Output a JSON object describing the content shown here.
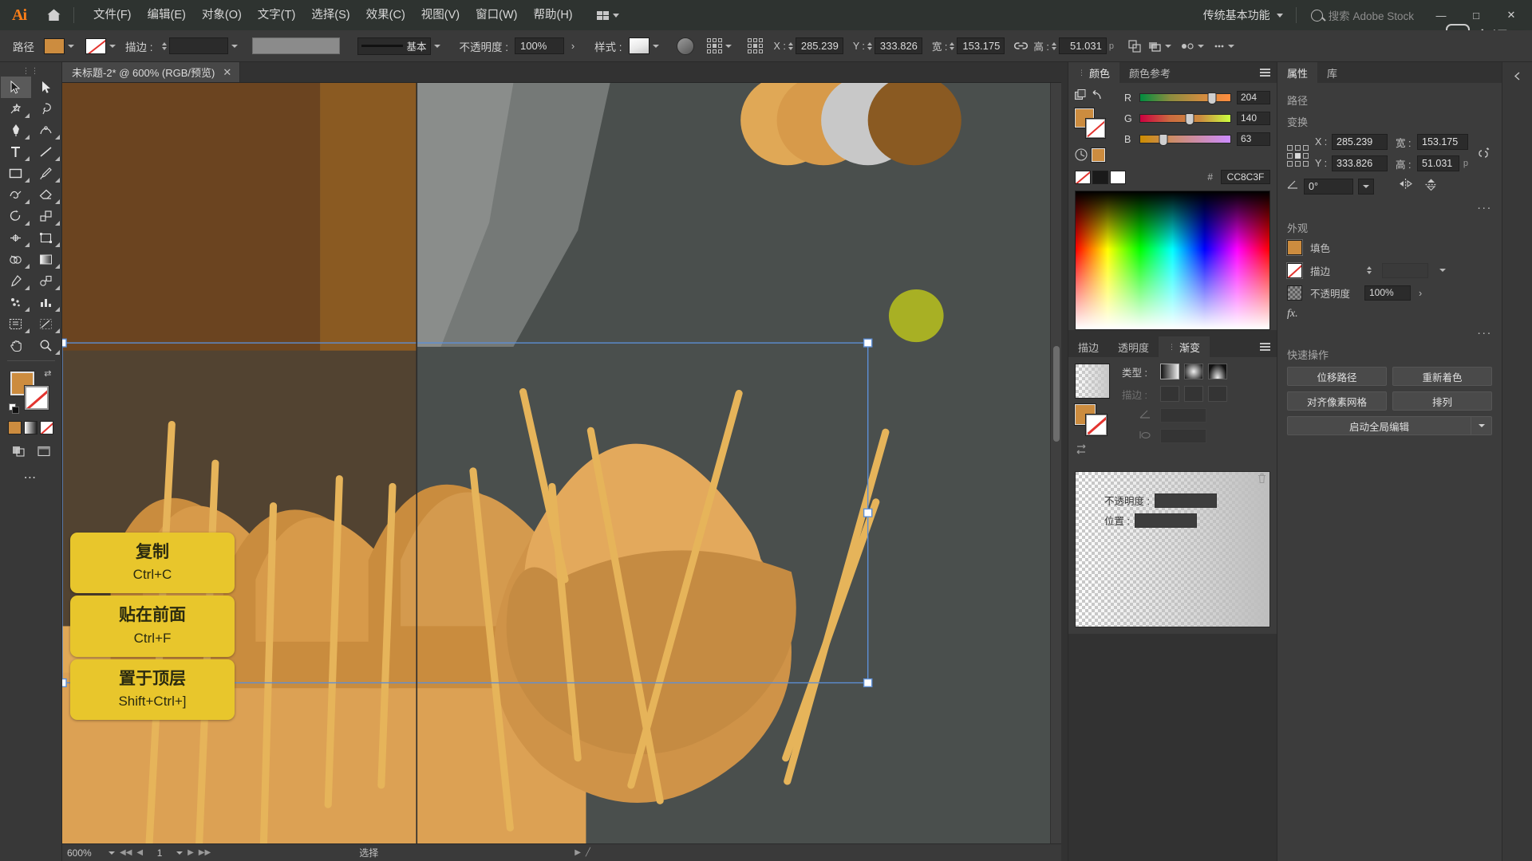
{
  "app": {
    "name": "Ai",
    "logo_color": "#ff7f18"
  },
  "menubar": {
    "items": [
      "文件(F)",
      "编辑(E)",
      "对象(O)",
      "文字(T)",
      "选择(S)",
      "效果(C)",
      "视图(V)",
      "窗口(W)",
      "帮助(H)"
    ],
    "arrange_icon": "arrange-documents-icon",
    "workspace": "传统基本功能",
    "search_placeholder": "搜索 Adobe Stock",
    "window_controls": [
      "minimize",
      "maximize",
      "close"
    ]
  },
  "watermark": {
    "text": "虎课网"
  },
  "controlbar": {
    "object_label": "路径",
    "fill_color": "#CC8C3F",
    "stroke_label": "描边 :",
    "stroke_weight": "",
    "stroke_profile": "基本",
    "opacity_label": "不透明度 :",
    "opacity_value": "100%",
    "style_label": "样式 :",
    "x_label": "X :",
    "x_value": "285.239",
    "y_label": "Y :",
    "y_value": "333.826",
    "w_label": "宽 :",
    "w_value": "153.175",
    "h_label": "高 :",
    "h_value": "51.031",
    "h_unit": "p"
  },
  "toolbar": {
    "tools": [
      "selection-tool",
      "direct-selection-tool",
      "magic-wand-tool",
      "lasso-tool",
      "pen-tool",
      "curvature-tool",
      "type-tool",
      "line-segment-tool",
      "rectangle-tool",
      "paintbrush-tool",
      "shaper-tool",
      "eraser-tool",
      "rotate-tool",
      "scale-tool",
      "width-tool",
      "free-transform-tool",
      "shape-builder-tool",
      "gradient-tool",
      "eyedropper-tool",
      "blend-tool",
      "symbol-sprayer-tool",
      "column-graph-tool",
      "artboard-tool",
      "slice-tool",
      "hand-tool",
      "zoom-tool"
    ],
    "fill_color": "#CC8C3F",
    "stroke_color": "none",
    "color_modes": [
      "solid-color",
      "gradient",
      "none"
    ],
    "screen_modes": [
      "normal-screen-mode",
      "full-screen-mode"
    ],
    "more_label": "..."
  },
  "document": {
    "tab_title": "未标题-2* @ 600% (RGB/预览)",
    "close_label": "✕"
  },
  "statusbar": {
    "zoom": "600%",
    "artboard_number": "1",
    "status_text": "选择"
  },
  "panels": {
    "color": {
      "tabs": [
        {
          "label": "颜色",
          "active": true
        },
        {
          "label": "颜色参考",
          "active": false
        }
      ],
      "channels": [
        {
          "label": "R",
          "value": "204"
        },
        {
          "label": "G",
          "value": "140"
        },
        {
          "label": "B",
          "value": "63"
        }
      ],
      "hex_symbol": "#",
      "hex_value": "CC8C3F",
      "fill_color": "#CC8C3F"
    },
    "gradient": {
      "tabs": [
        {
          "label": "描边",
          "active": false
        },
        {
          "label": "透明度",
          "active": false
        },
        {
          "label": "渐变",
          "active": true
        }
      ],
      "type_label": "类型 :",
      "type_options": [
        "linear-gradient",
        "radial-gradient",
        "freeform-gradient"
      ],
      "stroke_label": "描边 :",
      "angle_label": "角度",
      "angle_value": "",
      "aspect_label": "长宽比",
      "aspect_value": "",
      "opacity_label": "不透明度 :",
      "opacity_value": "",
      "location_label": "位置 :",
      "location_value": "",
      "delete_icon": "trash-icon"
    },
    "properties": {
      "tabs": [
        {
          "label": "属性",
          "active": true
        },
        {
          "label": "库",
          "active": false
        }
      ],
      "object_type": "路径",
      "transform_title": "变换",
      "x_label": "X :",
      "x_value": "285.239",
      "y_label": "Y :",
      "y_value": "333.826",
      "w_label": "宽 :",
      "w_value": "153.175",
      "h_label": "高 :",
      "h_value": "51.031",
      "h_unit": "p",
      "angle_value": "0°",
      "link_icon": "unlink-icon",
      "flip_h_icon": "flip-horizontal-icon",
      "flip_v_icon": "flip-vertical-icon",
      "more_options": "...",
      "appearance_title": "外观",
      "appearance_rows": [
        {
          "label": "填色",
          "value": ""
        },
        {
          "label": "描边",
          "value": ""
        },
        {
          "label": "不透明度",
          "value": "100%"
        }
      ],
      "fx_label": "fx.",
      "quick_actions_title": "快速操作",
      "quick_actions": [
        "位移路径",
        "重新着色",
        "对齐像素网格",
        "排列"
      ],
      "global_edit": "启动全局编辑"
    }
  },
  "callouts": [
    {
      "title": "复制",
      "shortcut": "Ctrl+C"
    },
    {
      "title": "贴在前面",
      "shortcut": "Ctrl+F"
    },
    {
      "title": "置于顶层",
      "shortcut": "Shift+Ctrl+]"
    }
  ],
  "canvas": {
    "selection_color": "#5d8fd6",
    "artwork_colors": {
      "dark_brown": "#6b4420",
      "mid_brown": "#8a5a22",
      "gray_left": "#8c8c8c",
      "gray_bg": "#4a4f4d",
      "orange_light": "#e0a856",
      "orange": "#d79a4a",
      "orange_dark": "#c07f35",
      "straw": "#e6b45a",
      "olive": "#a8b024",
      "tan": "#d9a55e"
    }
  }
}
